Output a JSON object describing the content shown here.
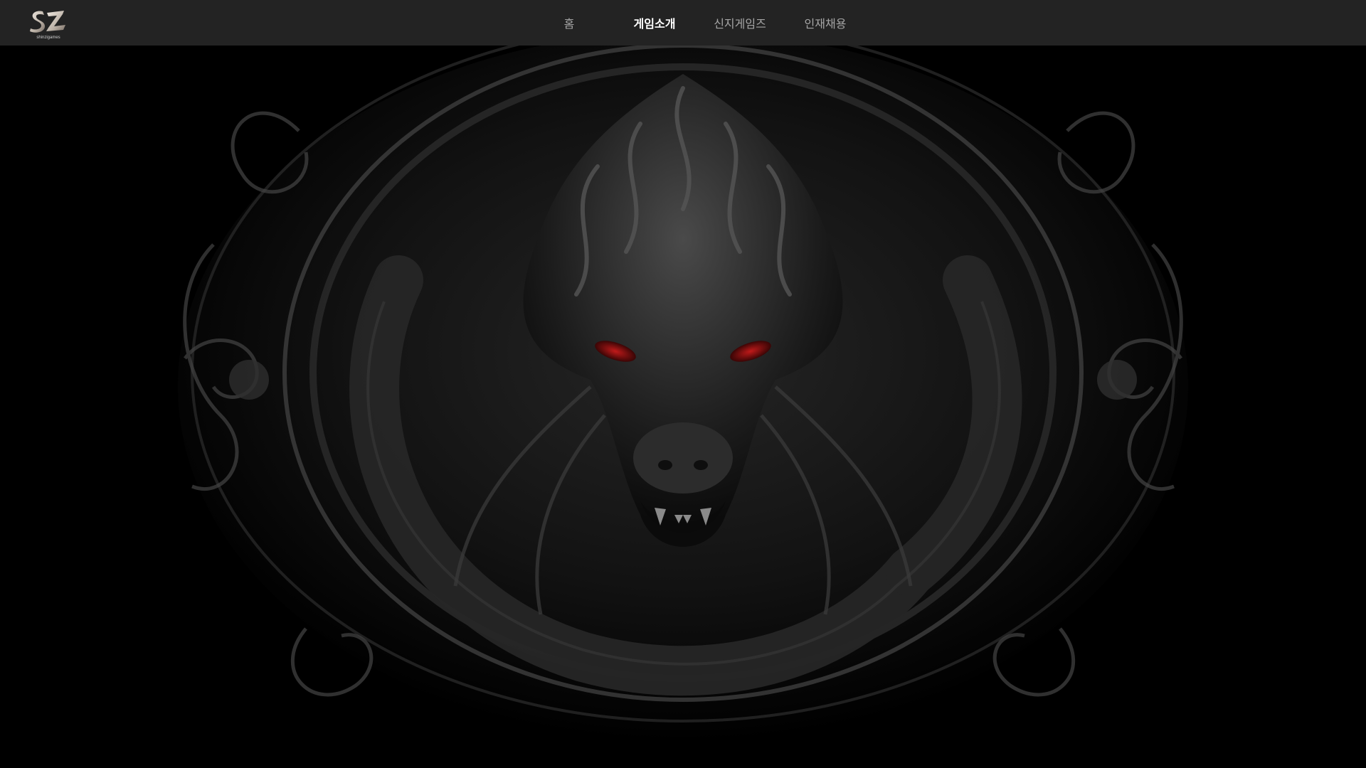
{
  "header": {
    "logo": {
      "letters": "SZ",
      "subtext": "shinzigames",
      "icon": "sz-logo-icon"
    },
    "nav": [
      {
        "label": "홈",
        "active": false
      },
      {
        "label": "게임소개",
        "active": true
      },
      {
        "label": "신지게임즈",
        "active": false
      },
      {
        "label": "인재채용",
        "active": false
      }
    ]
  },
  "hero": {
    "artwork": "dragon-emblem-image",
    "eye_color": "#8a0f0f"
  },
  "colors": {
    "header_bg": "#232323",
    "page_bg": "#000000",
    "nav_text": "#a6a6a6",
    "nav_active": "#ffffff"
  }
}
